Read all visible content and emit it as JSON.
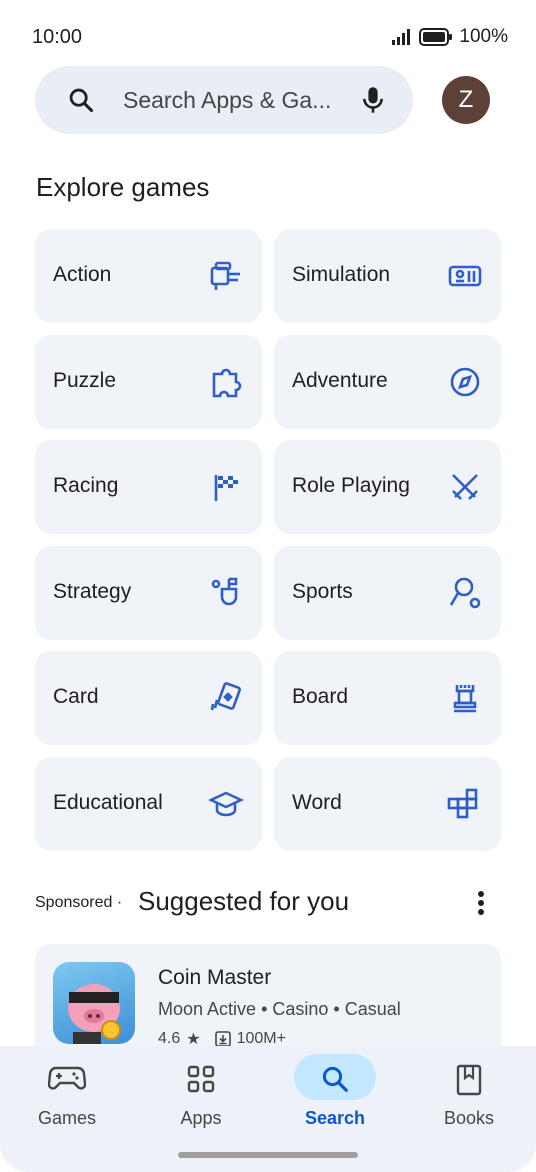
{
  "status_bar": {
    "time": "10:00",
    "battery": "100%"
  },
  "search": {
    "placeholder": "Search Apps & Ga...",
    "avatar_letter": "Z"
  },
  "section_title": "Explore games",
  "categories": [
    {
      "label": "Action",
      "icon": "action-icon"
    },
    {
      "label": "Simulation",
      "icon": "simulation-icon"
    },
    {
      "label": "Puzzle",
      "icon": "puzzle-icon"
    },
    {
      "label": "Adventure",
      "icon": "compass-icon"
    },
    {
      "label": "Racing",
      "icon": "checkered-flag-icon"
    },
    {
      "label": "Role Playing",
      "icon": "crossed-swords-icon"
    },
    {
      "label": "Strategy",
      "icon": "strategy-icon"
    },
    {
      "label": "Sports",
      "icon": "sports-icon"
    },
    {
      "label": "Card",
      "icon": "cards-icon"
    },
    {
      "label": "Board",
      "icon": "chess-rook-icon"
    },
    {
      "label": "Educational",
      "icon": "graduation-cap-icon"
    },
    {
      "label": "Word",
      "icon": "word-blocks-icon"
    }
  ],
  "suggested": {
    "sponsored_label": "Sponsored",
    "separator": "·",
    "title": "Suggested for you",
    "app": {
      "name": "Coin Master",
      "developer": "Moon Active",
      "genre1": "Casino",
      "genre2": "Casual",
      "rating": "4.6",
      "star": "★",
      "downloads": "100M+"
    }
  },
  "nav": [
    {
      "label": "Games",
      "icon": "gamepad-icon"
    },
    {
      "label": "Apps",
      "icon": "apps-grid-icon"
    },
    {
      "label": "Search",
      "icon": "search-icon",
      "active": true
    },
    {
      "label": "Books",
      "icon": "book-icon"
    }
  ],
  "colors": {
    "accent": "#0b57d0",
    "tile_bg": "#f0f3f8",
    "search_bg": "#e9eef6",
    "active_pill": "#c2e7ff"
  }
}
